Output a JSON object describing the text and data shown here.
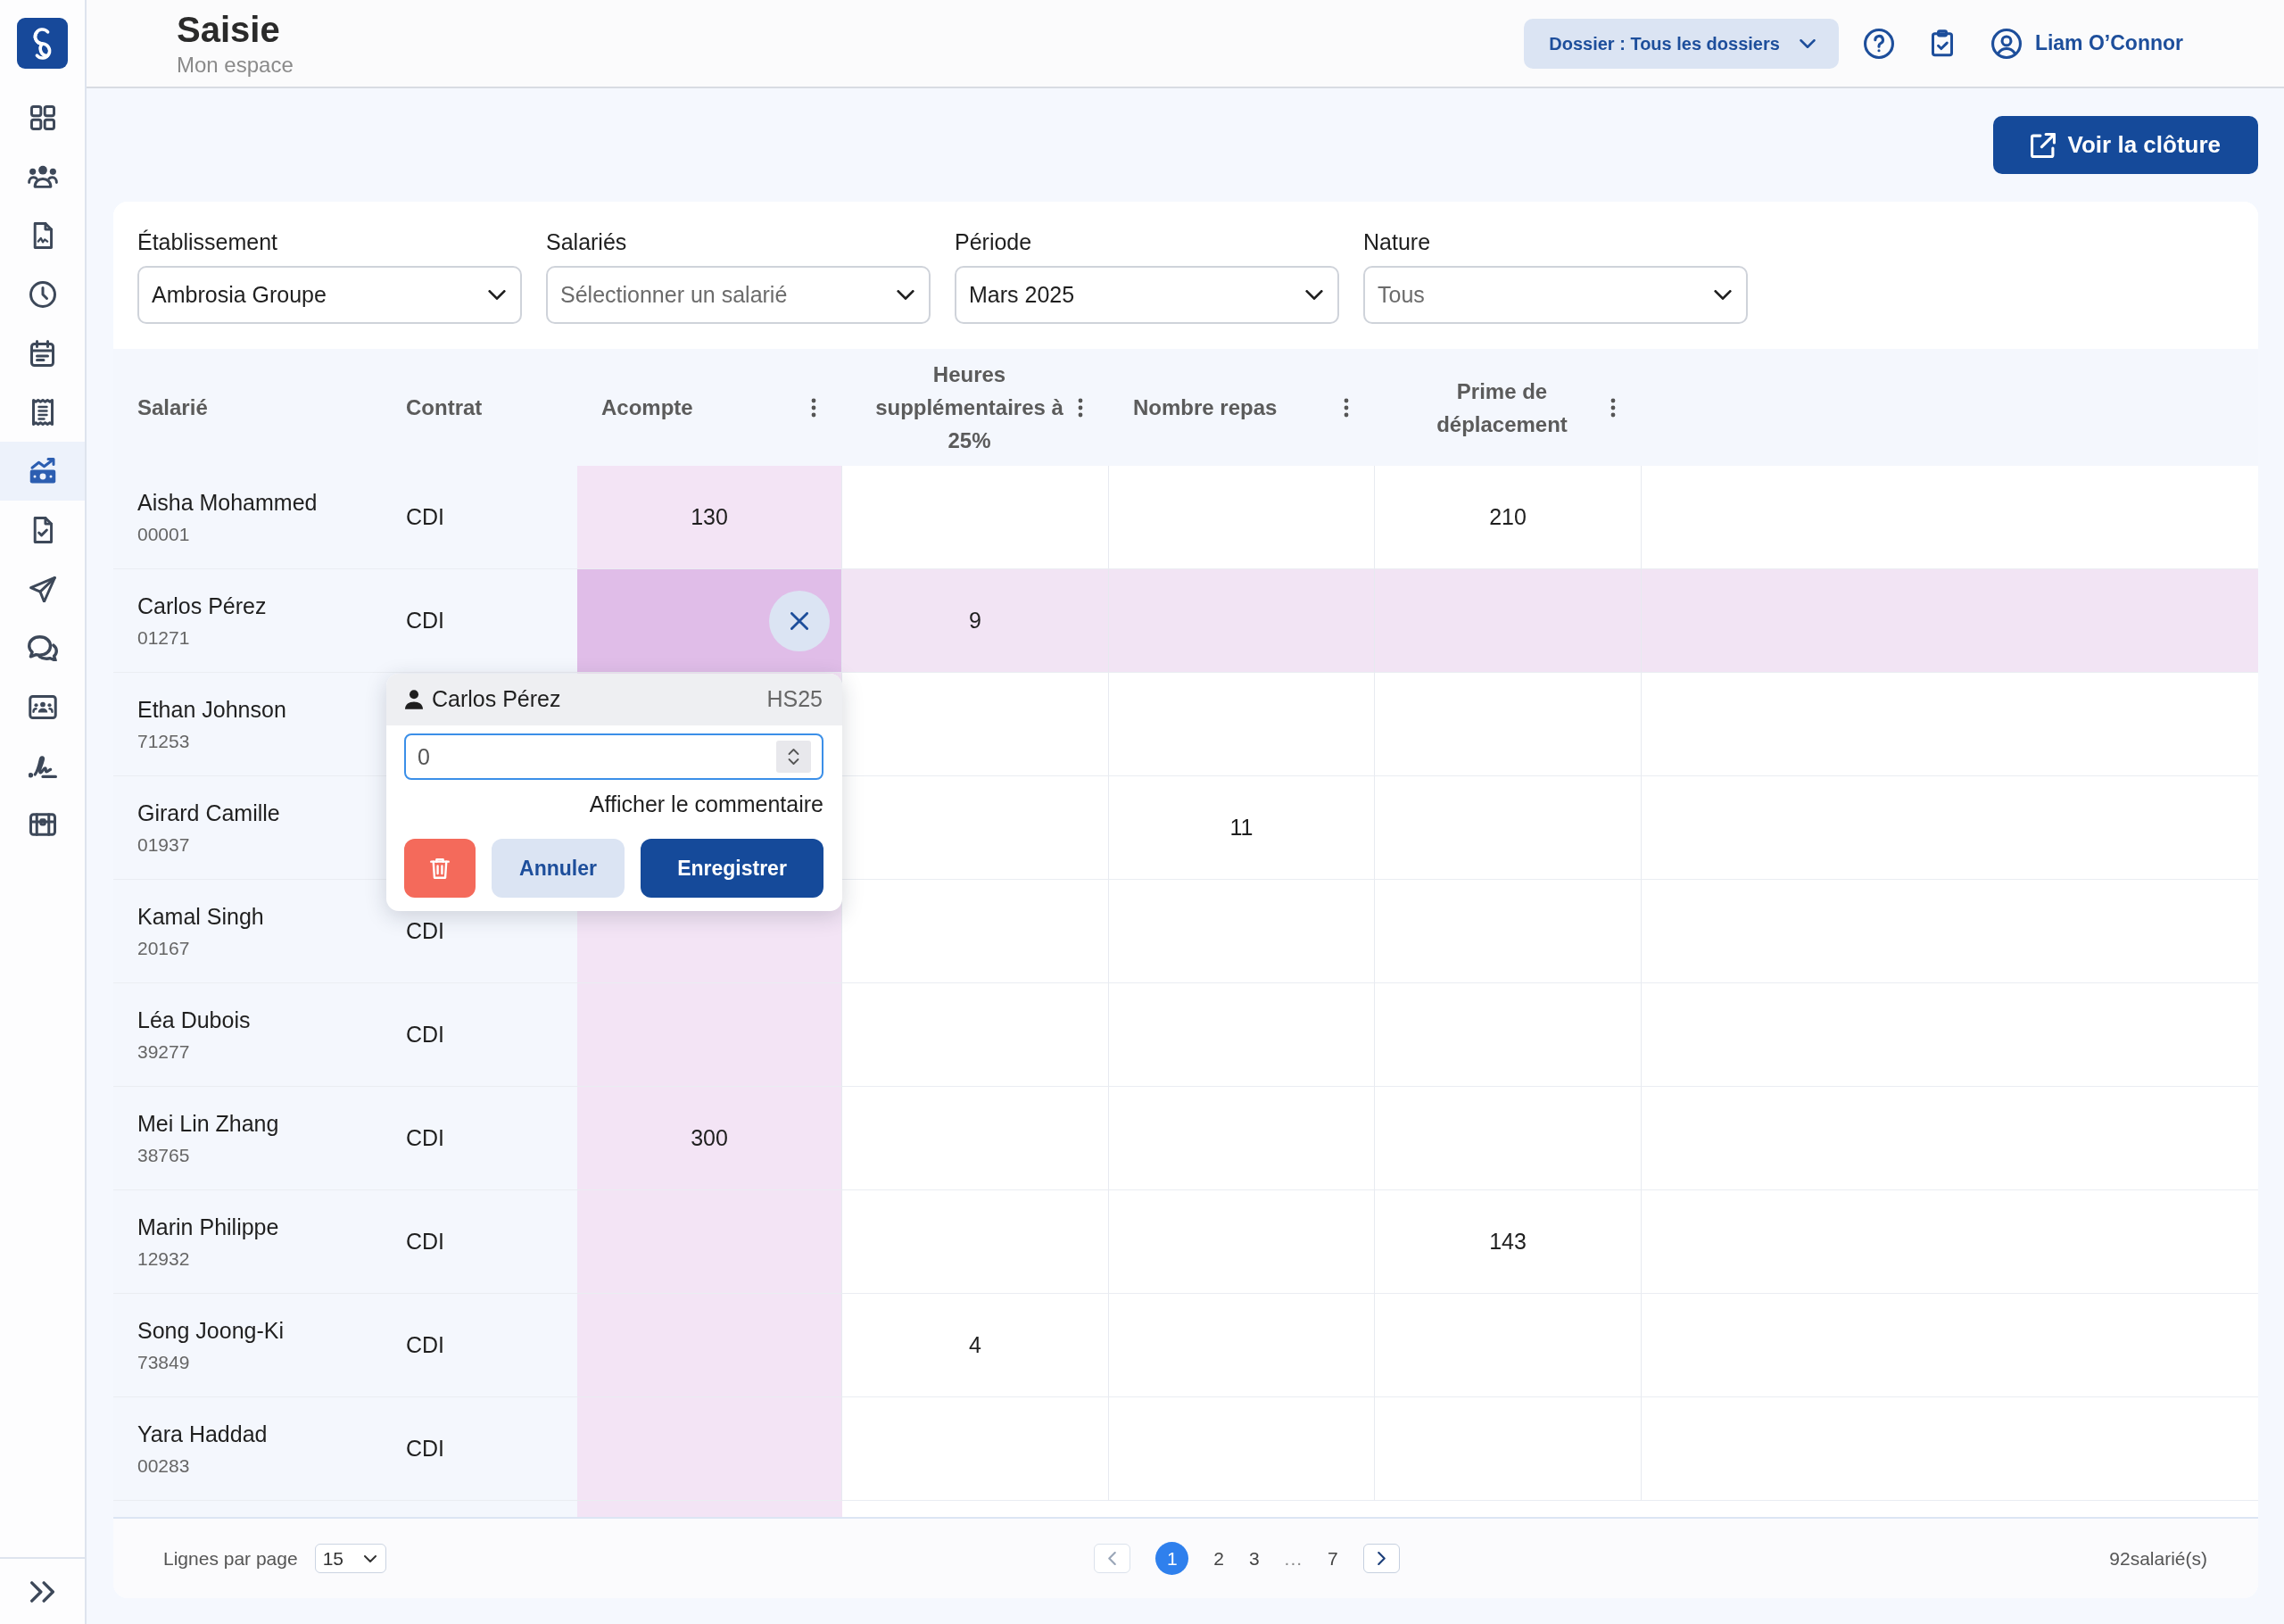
{
  "sidebar": {
    "items": [
      {
        "kind": "dashboard",
        "selected": false
      },
      {
        "kind": "team",
        "selected": false
      },
      {
        "kind": "report",
        "selected": false
      },
      {
        "kind": "clock",
        "selected": false
      },
      {
        "kind": "calendar",
        "selected": false
      },
      {
        "kind": "receipt",
        "selected": false
      },
      {
        "kind": "payroll",
        "selected": true
      },
      {
        "kind": "document-check",
        "selected": false
      },
      {
        "kind": "send",
        "selected": false
      },
      {
        "kind": "chat",
        "selected": false
      },
      {
        "kind": "directory",
        "selected": false
      },
      {
        "kind": "signature",
        "selected": false
      },
      {
        "kind": "chest",
        "selected": false
      }
    ]
  },
  "header": {
    "title": "Saisie",
    "subtitle": "Mon espace",
    "dossier": "Dossier : Tous les dossiers",
    "user": "Liam O’Connor"
  },
  "toolbar": {
    "button": "Voir la clôture"
  },
  "filters": [
    {
      "label": "Établissement",
      "value": "Ambrosia Groupe"
    },
    {
      "label": "Salariés",
      "placeholder": "Sélectionner un salarié"
    },
    {
      "label": "Période",
      "value": "Mars 2025"
    },
    {
      "label": "Nature",
      "placeholder": "Tous"
    }
  ],
  "table": {
    "columns": [
      {
        "label": "Salarié",
        "kind": "employee",
        "selected": false
      },
      {
        "label": "Contrat",
        "kind": "text",
        "selected": false
      },
      {
        "label": "Acompte",
        "kind": "value",
        "selected": true
      },
      {
        "label": "Heures supplémentaires à 25%",
        "kind": "value",
        "selected": false
      },
      {
        "label": "Nombre repas",
        "kind": "value",
        "selected": false
      },
      {
        "label": "Prime de déplacement",
        "kind": "value",
        "selected": false
      }
    ],
    "rows": [
      {
        "cells": [
          {
            "name": "Aisha Mohammed",
            "id": "00001"
          },
          "CDI",
          "130",
          null,
          null,
          "210"
        ],
        "selected": false
      },
      {
        "cells": [
          {
            "name": "Carlos Pérez",
            "id": "01271"
          },
          "CDI",
          null,
          "9",
          null,
          null
        ],
        "selected": true
      },
      {
        "cells": [
          {
            "name": "Ethan Johnson",
            "id": "71253"
          },
          null,
          null,
          null,
          null,
          null
        ],
        "selected": false
      },
      {
        "cells": [
          {
            "name": "Girard Camille",
            "id": "01937"
          },
          null,
          null,
          null,
          "11",
          null
        ],
        "selected": false
      },
      {
        "cells": [
          {
            "name": "Kamal Singh",
            "id": "20167"
          },
          "CDI",
          null,
          null,
          null,
          null
        ],
        "selected": false
      },
      {
        "cells": [
          {
            "name": "Léa Dubois",
            "id": "39277"
          },
          "CDI",
          null,
          null,
          null,
          null
        ],
        "selected": false
      },
      {
        "cells": [
          {
            "name": "Mei Lin Zhang",
            "id": "38765"
          },
          "CDI",
          "300",
          null,
          null,
          null
        ],
        "selected": false
      },
      {
        "cells": [
          {
            "name": "Marin Philippe",
            "id": "12932"
          },
          "CDI",
          null,
          null,
          null,
          "143"
        ],
        "selected": false
      },
      {
        "cells": [
          {
            "name": "Song Joong-Ki",
            "id": "73849"
          },
          "CDI",
          null,
          "4",
          null,
          null
        ],
        "selected": false
      },
      {
        "cells": [
          {
            "name": "Yara Haddad",
            "id": "00283"
          },
          "CDI",
          null,
          null,
          null,
          null
        ],
        "selected": false
      }
    ]
  },
  "editor": {
    "employee": "Carlos Pérez",
    "code": "HS25",
    "value": "0",
    "comment_link": "Afficher le commentaire",
    "cancel": "Annuler",
    "save": "Enregistrer"
  },
  "footer": {
    "rows_label": "Lignes par page",
    "rows_per_page": "15",
    "previous": {
      "disabled": true
    },
    "pages": [
      {
        "kind": "page",
        "label": "1",
        "selected": true
      },
      {
        "kind": "page",
        "label": "2",
        "selected": false
      },
      {
        "kind": "page",
        "label": "3",
        "selected": false
      },
      {
        "kind": "ellipsis",
        "label": "...",
        "selected": false
      },
      {
        "kind": "page",
        "label": "7",
        "selected": false
      }
    ],
    "next": {
      "disabled": false
    },
    "total": "92salarié(s)"
  }
}
